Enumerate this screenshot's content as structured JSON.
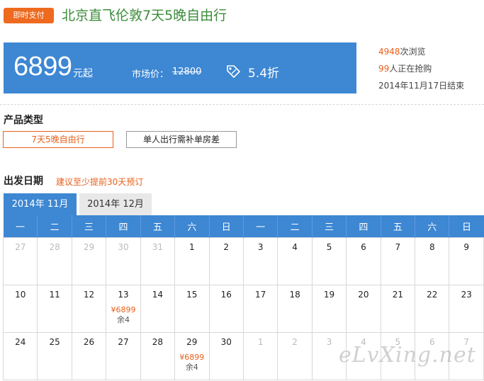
{
  "header": {
    "badge": "即时支付",
    "title": "北京直飞伦敦7天5晚自由行"
  },
  "pricebar": {
    "price": "6899",
    "price_unit": "元起",
    "market_label": "市场价：",
    "market_value": "12800",
    "discount": "5.4折",
    "discount_icon": "percent-tag-icon"
  },
  "side": {
    "views_count": "4948",
    "views_label": "次浏览",
    "buying_count": "99",
    "buying_label": "人正在抢购",
    "end_date": "2014年11月17日结束"
  },
  "product_type": {
    "title": "产品类型",
    "options": [
      "7天5晚自由行",
      "单人出行需补单房差"
    ],
    "selected": 0
  },
  "departure": {
    "title": "出发日期",
    "hint": "建议至少提前30天预订"
  },
  "tabs": [
    "2014年 11月",
    "2014年 12月"
  ],
  "calendar": {
    "weekdays": [
      "一",
      "二",
      "三",
      "四",
      "五",
      "六",
      "日",
      "一",
      "二",
      "三",
      "四",
      "五",
      "六",
      "日"
    ],
    "rows": [
      [
        {
          "d": "27",
          "o": true
        },
        {
          "d": "28",
          "o": true
        },
        {
          "d": "29",
          "o": true
        },
        {
          "d": "30",
          "o": true
        },
        {
          "d": "31",
          "o": true
        },
        {
          "d": "1"
        },
        {
          "d": "2"
        },
        {
          "d": "3"
        },
        {
          "d": "4"
        },
        {
          "d": "5"
        },
        {
          "d": "6"
        },
        {
          "d": "7"
        },
        {
          "d": "8"
        },
        {
          "d": "9"
        }
      ],
      [
        {
          "d": "10"
        },
        {
          "d": "11"
        },
        {
          "d": "12"
        },
        {
          "d": "13",
          "p": "¥6899",
          "r": "余4"
        },
        {
          "d": "14"
        },
        {
          "d": "15"
        },
        {
          "d": "16"
        },
        {
          "d": "17"
        },
        {
          "d": "18"
        },
        {
          "d": "19"
        },
        {
          "d": "20"
        },
        {
          "d": "21"
        },
        {
          "d": "22"
        },
        {
          "d": "23"
        }
      ],
      [
        {
          "d": "24"
        },
        {
          "d": "25"
        },
        {
          "d": "26"
        },
        {
          "d": "27"
        },
        {
          "d": "28"
        },
        {
          "d": "29",
          "p": "¥6899",
          "r": "余4"
        },
        {
          "d": "30"
        },
        {
          "d": "1",
          "o": true
        },
        {
          "d": "2",
          "o": true
        },
        {
          "d": "3",
          "o": true
        },
        {
          "d": "4",
          "o": true
        },
        {
          "d": "5",
          "o": true
        },
        {
          "d": "6",
          "o": true
        },
        {
          "d": "7",
          "o": true
        }
      ]
    ]
  },
  "watermark": "eLvXing.net",
  "colors": {
    "accent": "#3d87d3",
    "orange": "#e8601c",
    "title_green": "#3c8c3a"
  }
}
